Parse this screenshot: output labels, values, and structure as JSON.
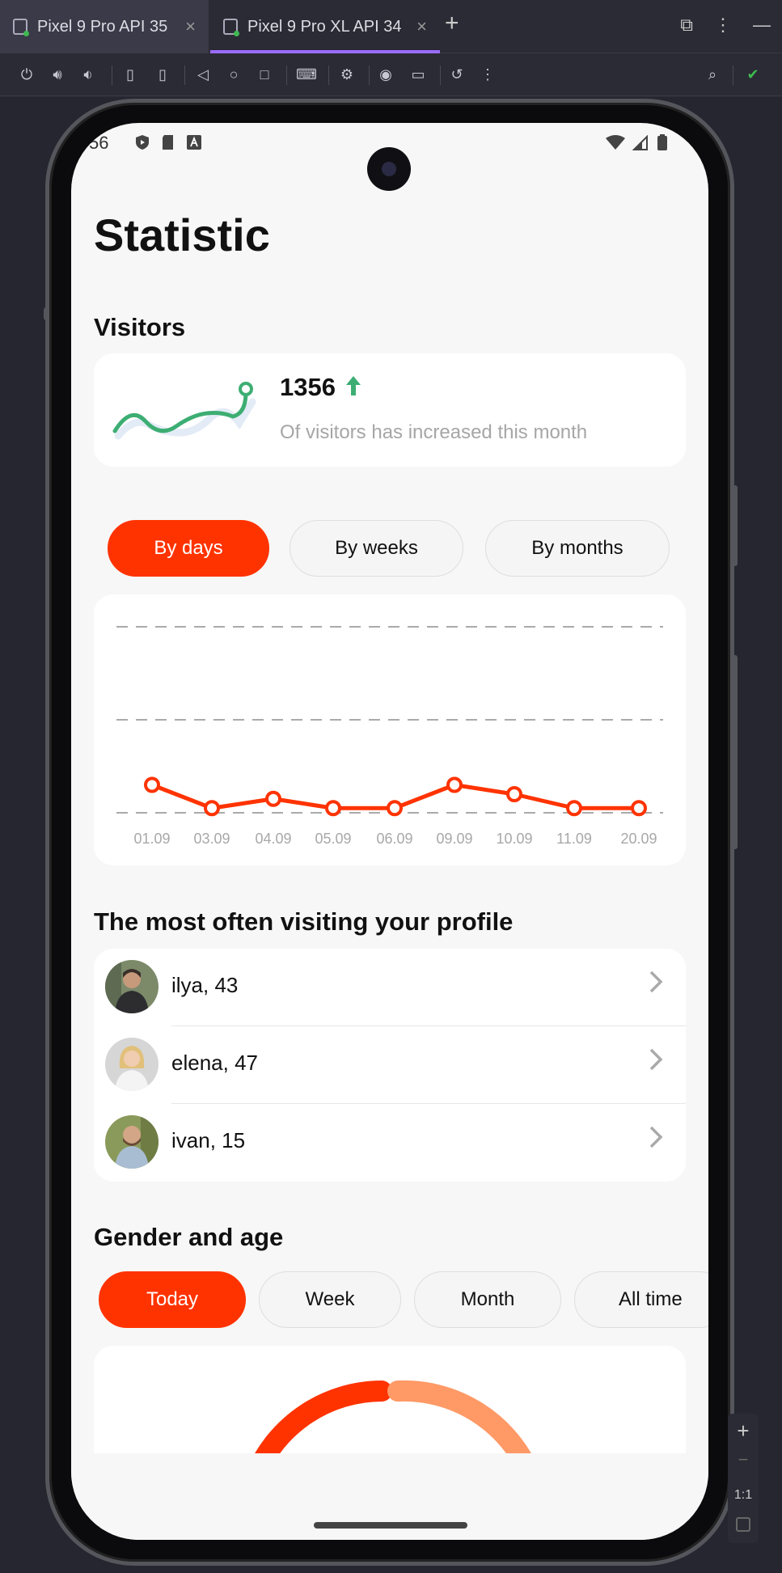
{
  "ide": {
    "tabs": [
      {
        "label": "Pixel 9 Pro API 35",
        "close": "×"
      },
      {
        "label": "Pixel 9 Pro XL API 34",
        "close": "×"
      }
    ],
    "new_tab": "+",
    "window_icons": [
      "restore-icon",
      "more-icon",
      "minimize-icon"
    ],
    "toolbar_icons": [
      "power-icon",
      "volume-up-icon",
      "volume-down-icon",
      "rotate-left-icon",
      "rotate-right-icon",
      "back-icon",
      "home-icon",
      "overview-icon",
      "keyboard-icon",
      "device-settings-icon",
      "screenshot-icon",
      "screenrecord-icon",
      "snapshot-icon",
      "more-icon",
      "inspect-icon",
      "check-icon"
    ],
    "zoom": {
      "plus": "+",
      "minus": "−",
      "ratio": "1:1"
    }
  },
  "phone": {
    "status_time": "56",
    "title": "Statistic",
    "visitors": {
      "heading": "Visitors",
      "count": "1356",
      "description": "Of visitors has increased this month"
    },
    "period_tabs": [
      "By days",
      "By weeks",
      "By months"
    ],
    "active_period": "By days",
    "most_visiting": {
      "heading": "The most often visiting your profile",
      "items": [
        {
          "name": "ilya, 43"
        },
        {
          "name": "elena, 47"
        },
        {
          "name": "ivan, 15"
        }
      ]
    },
    "gender_age": {
      "heading": "Gender and age",
      "ranges": [
        "Today",
        "Week",
        "Month",
        "All time"
      ],
      "active_range": "Today"
    }
  },
  "colors": {
    "accent": "#ff3300",
    "accent_light": "#ff9966",
    "positive": "#3dae73",
    "background": "#f7f7f7"
  },
  "chart_data": {
    "type": "line",
    "categories": [
      "01.09",
      "03.09",
      "04.09",
      "05.09",
      "06.09",
      "09.09",
      "10.09",
      "11.09",
      "20.09"
    ],
    "values": [
      3,
      0.5,
      1.5,
      0.5,
      0.5,
      3,
      2,
      0.5,
      0.5
    ],
    "ylim": [
      0,
      20
    ],
    "grid": "dashed horizontal",
    "color": "#ff3300"
  }
}
